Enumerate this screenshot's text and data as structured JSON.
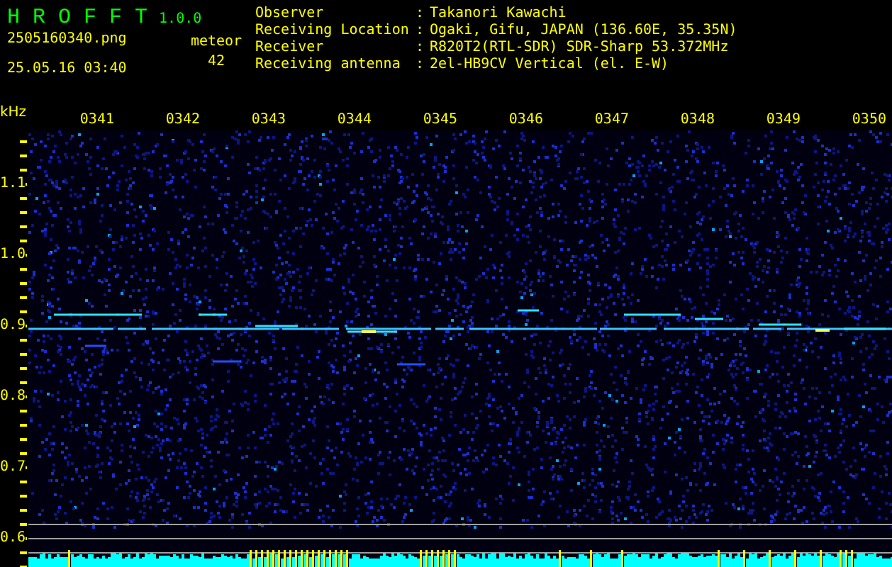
{
  "app": {
    "name": "H R O F F T",
    "version": "1.0.0"
  },
  "file": {
    "name": "2505160340.png",
    "datetime": "25.05.16 03:40"
  },
  "meteor": {
    "label": "meteor",
    "count": "42"
  },
  "info": [
    {
      "label": "Observer",
      "sep": ":",
      "value": "Takanori Kawachi"
    },
    {
      "label": "Receiving Location",
      "sep": ":",
      "value": "Ogaki, Gifu, JAPAN (136.60E, 35.35N)"
    },
    {
      "label": "Receiver",
      "sep": ":",
      "value": "R820T2(RTL-SDR) SDR-Sharp 53.372MHz"
    },
    {
      "label": "Receiving antenna",
      "sep": ":",
      "value": "2el-HB9CV Vertical (el. E-W)"
    }
  ],
  "axis": {
    "unit": "kHz",
    "time_labels": [
      "0341",
      "0342",
      "0343",
      "0344",
      "0345",
      "0346",
      "0347",
      "0348",
      "0349",
      "0350"
    ],
    "freq_labels": [
      "1.1",
      "1.0",
      "0.9",
      "0.8",
      "0.7",
      "0.6"
    ]
  }
}
